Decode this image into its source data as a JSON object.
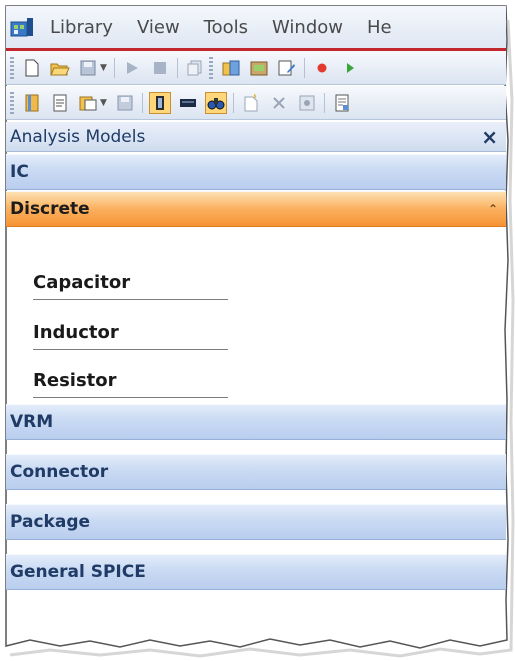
{
  "menubar": {
    "items": [
      "Library",
      "View",
      "Tools",
      "Window",
      "He"
    ]
  },
  "panel": {
    "title": "Analysis Models",
    "close_glyph": "×"
  },
  "categories": {
    "ic": "IC",
    "discrete": "Discrete",
    "vrm": "VRM",
    "connector": "Connector",
    "package": "Package",
    "general_spice": "General SPICE"
  },
  "discrete_items": [
    "Capacitor",
    "Inductor",
    "Resistor"
  ],
  "icons": {
    "toolbar1": [
      "new-file-icon",
      "open-folder-icon",
      "save-icon",
      "play-icon",
      "stop-icon",
      "copy-icon",
      "library-icon",
      "browse-icon",
      "edit-icon",
      "record-icon",
      "run-icon"
    ],
    "toolbar2": [
      "book-icon",
      "notes-icon",
      "clipboard-icon",
      "save-disabled-icon",
      "panel-icon",
      "keyboard-icon",
      "find-icon",
      "new-doc-icon",
      "delete-icon",
      "properties-icon",
      "report-icon"
    ]
  },
  "colors": {
    "accent_red": "#c0262b",
    "active_orange": "#f69434",
    "category_blue": "#c9daf3",
    "text_navy": "#1f3b66"
  }
}
